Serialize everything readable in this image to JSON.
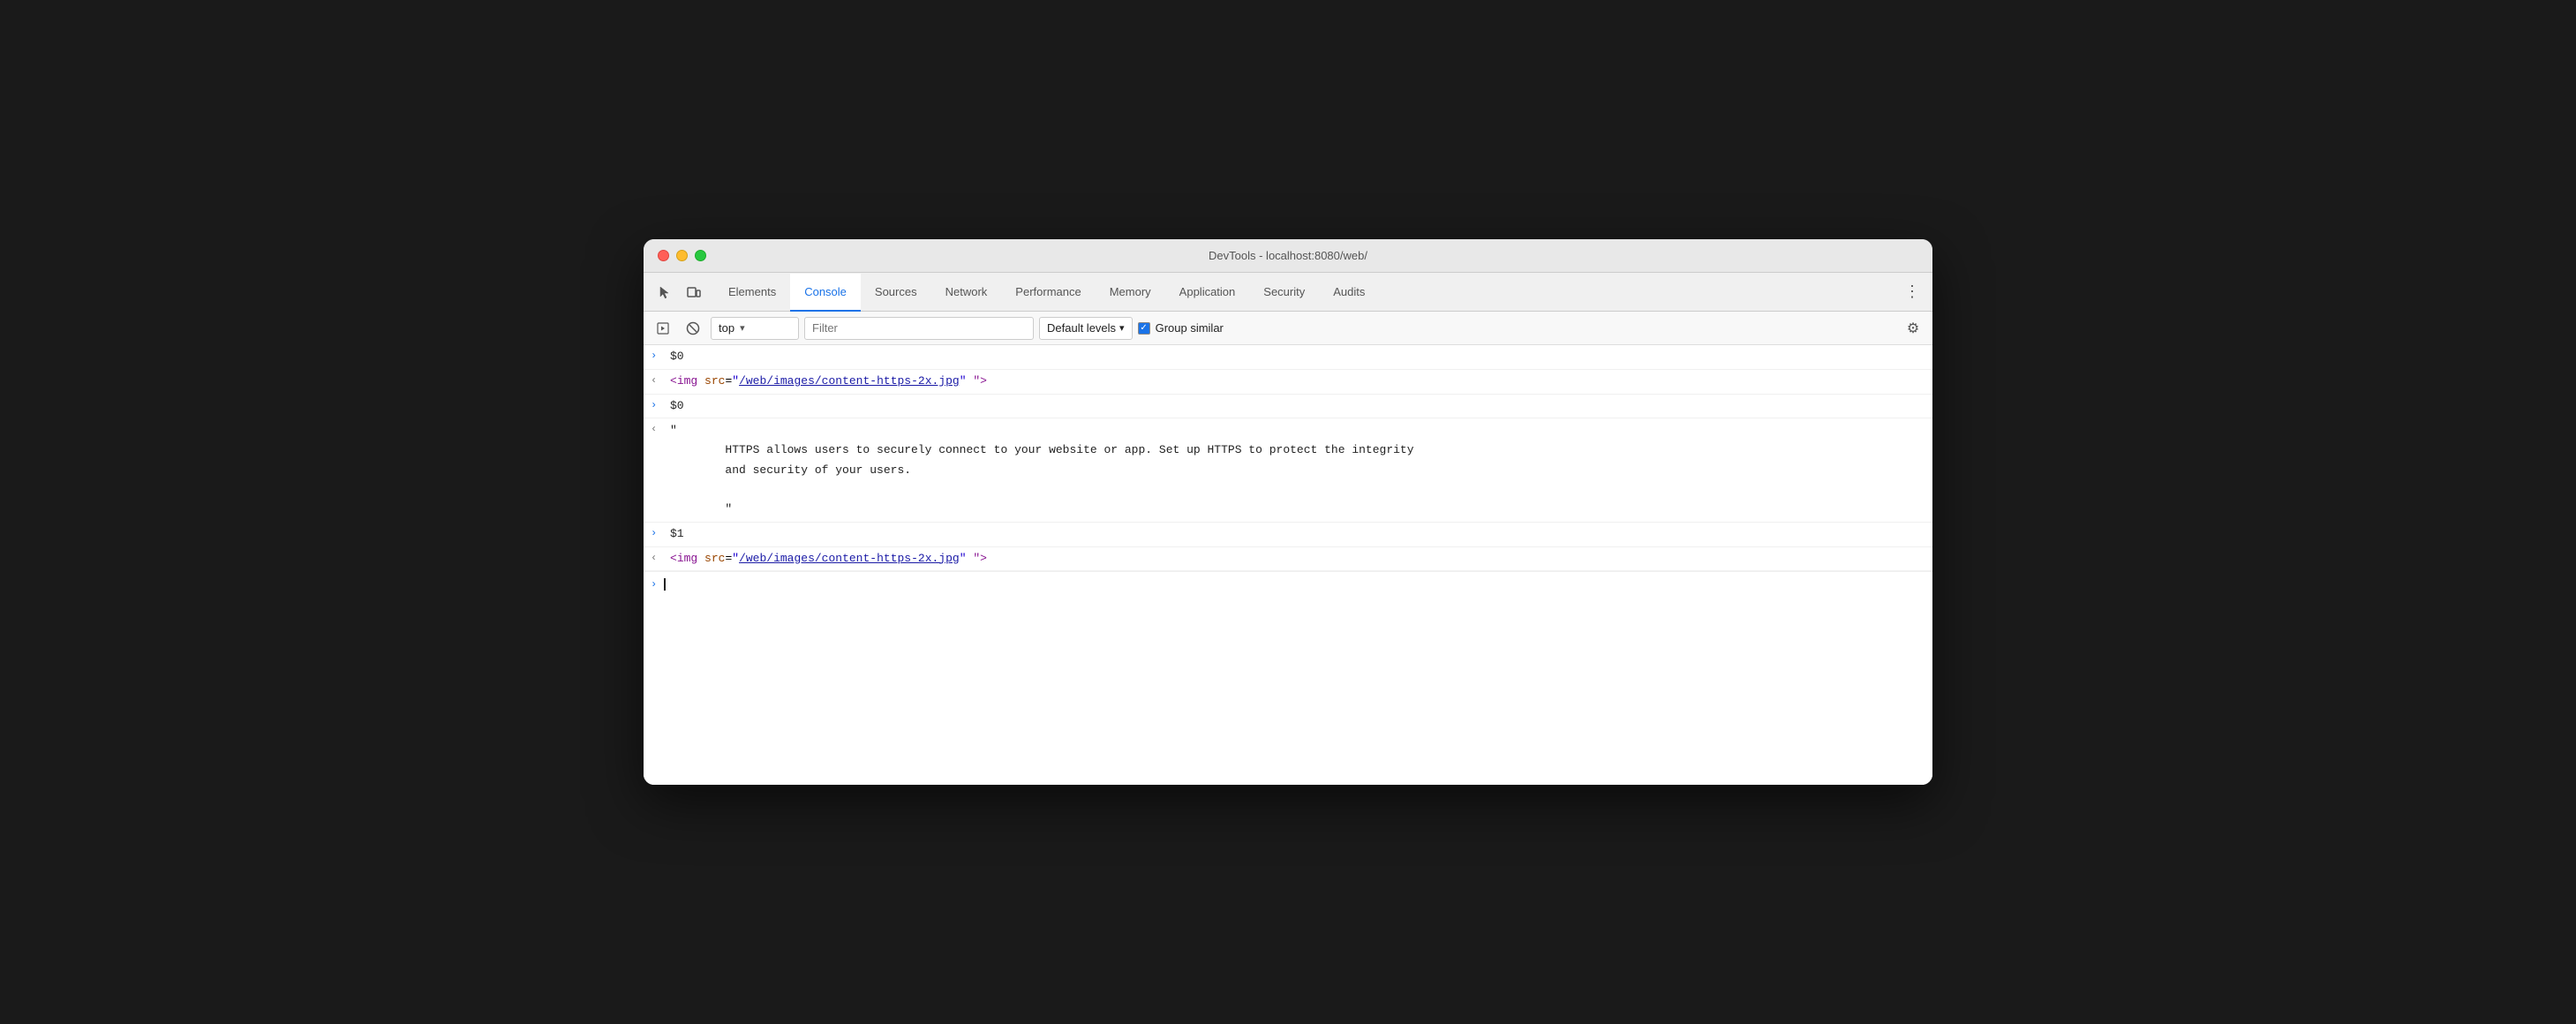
{
  "window": {
    "title": "DevTools - localhost:8080/web/"
  },
  "traffic_lights": {
    "close": "close",
    "minimize": "minimize",
    "maximize": "maximize"
  },
  "tabs": [
    {
      "id": "elements",
      "label": "Elements",
      "active": false
    },
    {
      "id": "console",
      "label": "Console",
      "active": true
    },
    {
      "id": "sources",
      "label": "Sources",
      "active": false
    },
    {
      "id": "network",
      "label": "Network",
      "active": false
    },
    {
      "id": "performance",
      "label": "Performance",
      "active": false
    },
    {
      "id": "memory",
      "label": "Memory",
      "active": false
    },
    {
      "id": "application",
      "label": "Application",
      "active": false
    },
    {
      "id": "security",
      "label": "Security",
      "active": false
    },
    {
      "id": "audits",
      "label": "Audits",
      "active": false
    }
  ],
  "toolbar": {
    "context": "top",
    "context_arrow": "▾",
    "filter_placeholder": "Filter",
    "levels_label": "Default levels",
    "levels_arrow": "▾",
    "group_similar_label": "Group similar",
    "settings_icon": "⚙"
  },
  "console_entries": [
    {
      "type": "input",
      "arrow": ">",
      "content": "$0"
    },
    {
      "type": "output",
      "arrow": "<",
      "html_tag": "img",
      "attr_name": "src",
      "attr_value": "/web/images/content-https-2x.jpg",
      "suffix": "\" \">"
    },
    {
      "type": "input",
      "arrow": ">",
      "content": "$0"
    },
    {
      "type": "output_multiline",
      "arrow": "<",
      "quote_open": "\"",
      "text_body": "        HTTPS allows users to securely connect to your website or app. Set up HTTPS to protect the integrity\n        and security of your users.\n\n        \"",
      "quote_close": ""
    },
    {
      "type": "input",
      "arrow": ">",
      "content": "$1"
    },
    {
      "type": "output",
      "arrow": "<",
      "html_tag": "img",
      "attr_name": "src",
      "attr_value": "/web/images/content-https-2x.jpg",
      "suffix": "\" \">"
    }
  ],
  "prompt": {
    "arrow": ">"
  }
}
